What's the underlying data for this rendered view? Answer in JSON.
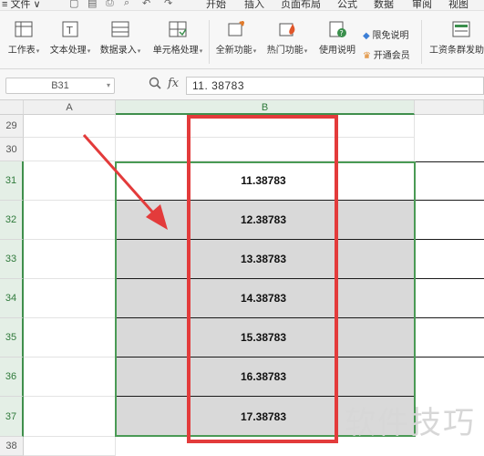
{
  "menubar": {
    "file_label": "文件",
    "tabs": [
      "开始",
      "插入",
      "页面布局",
      "公式",
      "数据",
      "审阅",
      "视图"
    ]
  },
  "ribbon": {
    "buttons": [
      {
        "label": "工作表",
        "icon": "worksheet-icon",
        "has_dropdown": true
      },
      {
        "label": "文本处理",
        "icon": "text-process-icon",
        "has_dropdown": true
      },
      {
        "label": "数据录入",
        "icon": "data-entry-icon",
        "has_dropdown": true
      },
      {
        "label": "单元格处理",
        "icon": "cell-process-icon",
        "has_dropdown": true
      },
      {
        "label": "全新功能",
        "icon": "new-feature-icon",
        "has_dropdown": true
      },
      {
        "label": "热门功能",
        "icon": "hot-feature-icon",
        "has_dropdown": true
      },
      {
        "label": "使用说明",
        "icon": "help-icon",
        "has_dropdown": false
      },
      {
        "label": "工资条群发助手",
        "icon": "payroll-icon",
        "has_dropdown": false
      }
    ],
    "promo_free": "限免说明",
    "promo_member": "开通会员"
  },
  "formula_bar": {
    "name_box": "B31",
    "fx_label": "fx",
    "value": "11. 38783"
  },
  "grid": {
    "columns": [
      "A",
      "B"
    ],
    "rows": [
      {
        "num": "29",
        "value": ""
      },
      {
        "num": "30",
        "value": ""
      },
      {
        "num": "31",
        "value": "11.38783"
      },
      {
        "num": "32",
        "value": "12.38783"
      },
      {
        "num": "33",
        "value": "13.38783"
      },
      {
        "num": "34",
        "value": "14.38783"
      },
      {
        "num": "35",
        "value": "15.38783"
      },
      {
        "num": "36",
        "value": "16.38783"
      },
      {
        "num": "37",
        "value": "17.38783"
      },
      {
        "num": "38",
        "value": ""
      }
    ]
  },
  "watermark": "软件技巧",
  "colors": {
    "selection_green": "#4a9a55",
    "highlight_red": "#e33b3b",
    "cell_gray": "#d9d9d9"
  }
}
